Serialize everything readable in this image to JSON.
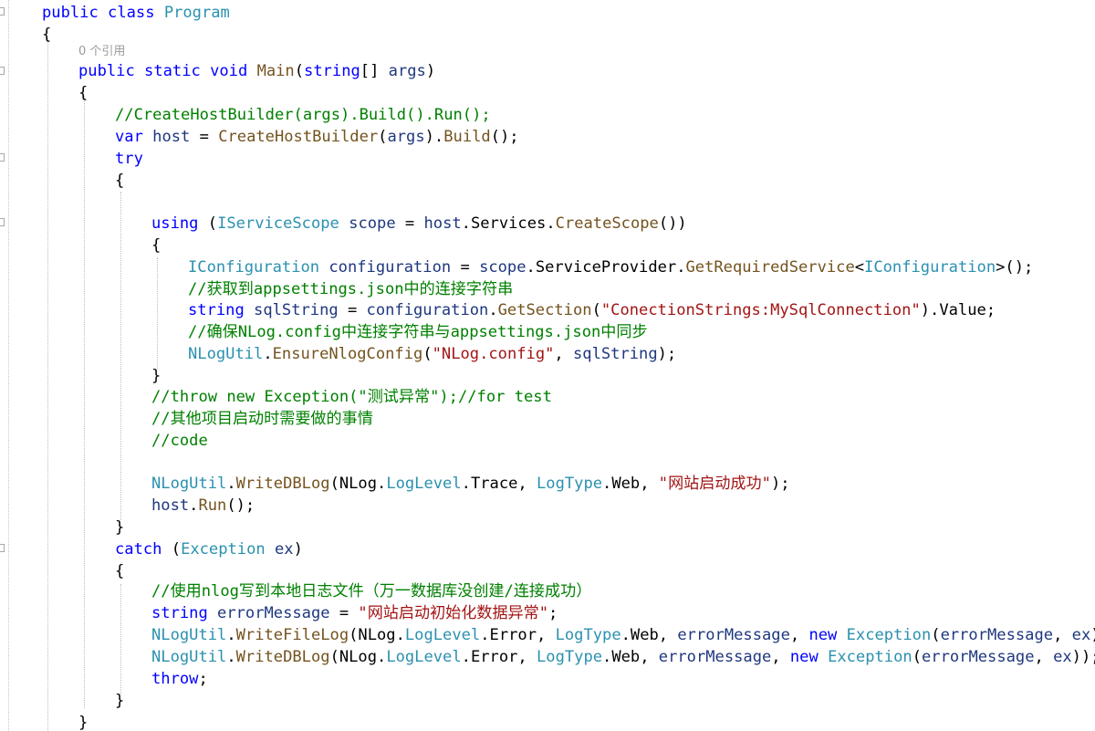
{
  "code_reference_label": "0 个引用",
  "lines": [
    {
      "indent": 1,
      "tokens": [
        {
          "k": "kw",
          "t": "public"
        },
        {
          "k": "pl",
          "t": " "
        },
        {
          "k": "kw",
          "t": "class"
        },
        {
          "k": "pl",
          "t": " "
        },
        {
          "k": "ty",
          "t": "Program"
        }
      ]
    },
    {
      "indent": 1,
      "tokens": [
        {
          "k": "pl",
          "t": "{"
        }
      ]
    },
    {
      "indent": 2,
      "tokens": [
        {
          "k": "kw",
          "t": "public"
        },
        {
          "k": "pl",
          "t": " "
        },
        {
          "k": "kw",
          "t": "static"
        },
        {
          "k": "pl",
          "t": " "
        },
        {
          "k": "kw",
          "t": "void"
        },
        {
          "k": "pl",
          "t": " "
        },
        {
          "k": "fn",
          "t": "Main"
        },
        {
          "k": "pl",
          "t": "("
        },
        {
          "k": "kw",
          "t": "string"
        },
        {
          "k": "pl",
          "t": "[] "
        },
        {
          "k": "vr",
          "t": "args"
        },
        {
          "k": "pl",
          "t": ")"
        }
      ]
    },
    {
      "indent": 2,
      "tokens": [
        {
          "k": "pl",
          "t": "{"
        }
      ]
    },
    {
      "indent": 3,
      "tokens": [
        {
          "k": "cm",
          "t": "//CreateHostBuilder(args).Build().Run();"
        }
      ]
    },
    {
      "indent": 3,
      "tokens": [
        {
          "k": "kw",
          "t": "var"
        },
        {
          "k": "pl",
          "t": " "
        },
        {
          "k": "vr",
          "t": "host"
        },
        {
          "k": "pl",
          "t": " = "
        },
        {
          "k": "fn",
          "t": "CreateHostBuilder"
        },
        {
          "k": "pl",
          "t": "("
        },
        {
          "k": "vr",
          "t": "args"
        },
        {
          "k": "pl",
          "t": ")."
        },
        {
          "k": "fn",
          "t": "Build"
        },
        {
          "k": "pl",
          "t": "();"
        }
      ]
    },
    {
      "indent": 3,
      "tokens": [
        {
          "k": "kw",
          "t": "try"
        }
      ]
    },
    {
      "indent": 3,
      "tokens": [
        {
          "k": "pl",
          "t": "{"
        }
      ]
    },
    {
      "indent": 0,
      "tokens": []
    },
    {
      "indent": 4,
      "tokens": [
        {
          "k": "kw",
          "t": "using"
        },
        {
          "k": "pl",
          "t": " ("
        },
        {
          "k": "ty",
          "t": "IServiceScope"
        },
        {
          "k": "pl",
          "t": " "
        },
        {
          "k": "vr",
          "t": "scope"
        },
        {
          "k": "pl",
          "t": " = "
        },
        {
          "k": "vr",
          "t": "host"
        },
        {
          "k": "pl",
          "t": "."
        },
        {
          "k": "pl",
          "t": "Services"
        },
        {
          "k": "pl",
          "t": "."
        },
        {
          "k": "fn",
          "t": "CreateScope"
        },
        {
          "k": "pl",
          "t": "())"
        }
      ]
    },
    {
      "indent": 4,
      "tokens": [
        {
          "k": "pl",
          "t": "{"
        }
      ]
    },
    {
      "indent": 5,
      "tokens": [
        {
          "k": "ty",
          "t": "IConfiguration"
        },
        {
          "k": "pl",
          "t": " "
        },
        {
          "k": "vr",
          "t": "configuration"
        },
        {
          "k": "pl",
          "t": " = "
        },
        {
          "k": "vr",
          "t": "scope"
        },
        {
          "k": "pl",
          "t": "."
        },
        {
          "k": "pl",
          "t": "ServiceProvider"
        },
        {
          "k": "pl",
          "t": "."
        },
        {
          "k": "fn",
          "t": "GetRequiredService"
        },
        {
          "k": "pl",
          "t": "<"
        },
        {
          "k": "ty",
          "t": "IConfiguration"
        },
        {
          "k": "pl",
          "t": ">();"
        }
      ]
    },
    {
      "indent": 5,
      "tokens": [
        {
          "k": "cm",
          "t": "//获取到appsettings.json中的连接字符串"
        }
      ]
    },
    {
      "indent": 5,
      "tokens": [
        {
          "k": "kw",
          "t": "string"
        },
        {
          "k": "pl",
          "t": " "
        },
        {
          "k": "vr",
          "t": "sqlString"
        },
        {
          "k": "pl",
          "t": " = "
        },
        {
          "k": "vr",
          "t": "configuration"
        },
        {
          "k": "pl",
          "t": "."
        },
        {
          "k": "fn",
          "t": "GetSection"
        },
        {
          "k": "pl",
          "t": "("
        },
        {
          "k": "st",
          "t": "\"ConectionStrings:MySqlConnection\""
        },
        {
          "k": "pl",
          "t": ").Value;"
        }
      ]
    },
    {
      "indent": 5,
      "tokens": [
        {
          "k": "cm",
          "t": "//确保NLog.config中连接字符串与appsettings.json中同步"
        }
      ]
    },
    {
      "indent": 5,
      "tokens": [
        {
          "k": "ty",
          "t": "NLogUtil"
        },
        {
          "k": "pl",
          "t": "."
        },
        {
          "k": "fn",
          "t": "EnsureNlogConfig"
        },
        {
          "k": "pl",
          "t": "("
        },
        {
          "k": "st",
          "t": "\"NLog.config\""
        },
        {
          "k": "pl",
          "t": ", "
        },
        {
          "k": "vr",
          "t": "sqlString"
        },
        {
          "k": "pl",
          "t": ");"
        }
      ]
    },
    {
      "indent": 4,
      "tokens": [
        {
          "k": "pl",
          "t": "}"
        }
      ]
    },
    {
      "indent": 4,
      "tokens": [
        {
          "k": "cm",
          "t": "//throw new Exception(\"测试异常\");//for test"
        }
      ]
    },
    {
      "indent": 4,
      "tokens": [
        {
          "k": "cm",
          "t": "//其他项目启动时需要做的事情"
        }
      ]
    },
    {
      "indent": 4,
      "tokens": [
        {
          "k": "cm",
          "t": "//code"
        }
      ]
    },
    {
      "indent": 0,
      "tokens": []
    },
    {
      "indent": 4,
      "tokens": [
        {
          "k": "ty",
          "t": "NLogUtil"
        },
        {
          "k": "pl",
          "t": "."
        },
        {
          "k": "fn",
          "t": "WriteDBLog"
        },
        {
          "k": "pl",
          "t": "(NLog."
        },
        {
          "k": "ty",
          "t": "LogLevel"
        },
        {
          "k": "pl",
          "t": ".Trace, "
        },
        {
          "k": "ty",
          "t": "LogType"
        },
        {
          "k": "pl",
          "t": ".Web, "
        },
        {
          "k": "st",
          "t": "\"网站启动成功\""
        },
        {
          "k": "pl",
          "t": ");"
        }
      ]
    },
    {
      "indent": 4,
      "tokens": [
        {
          "k": "vr",
          "t": "host"
        },
        {
          "k": "pl",
          "t": "."
        },
        {
          "k": "fn",
          "t": "Run"
        },
        {
          "k": "pl",
          "t": "();"
        }
      ]
    },
    {
      "indent": 3,
      "tokens": [
        {
          "k": "pl",
          "t": "}"
        }
      ]
    },
    {
      "indent": 3,
      "tokens": [
        {
          "k": "kw",
          "t": "catch"
        },
        {
          "k": "pl",
          "t": " ("
        },
        {
          "k": "ty",
          "t": "Exception"
        },
        {
          "k": "pl",
          "t": " "
        },
        {
          "k": "vr",
          "t": "ex"
        },
        {
          "k": "pl",
          "t": ")"
        }
      ]
    },
    {
      "indent": 3,
      "tokens": [
        {
          "k": "pl",
          "t": "{"
        }
      ]
    },
    {
      "indent": 4,
      "tokens": [
        {
          "k": "cm",
          "t": "//使用nlog写到本地日志文件（万一数据库没创建/连接成功）"
        }
      ]
    },
    {
      "indent": 4,
      "tokens": [
        {
          "k": "kw",
          "t": "string"
        },
        {
          "k": "pl",
          "t": " "
        },
        {
          "k": "vr",
          "t": "errorMessage"
        },
        {
          "k": "pl",
          "t": " = "
        },
        {
          "k": "st",
          "t": "\"网站启动初始化数据异常\""
        },
        {
          "k": "pl",
          "t": ";"
        }
      ]
    },
    {
      "indent": 4,
      "tokens": [
        {
          "k": "ty",
          "t": "NLogUtil"
        },
        {
          "k": "pl",
          "t": "."
        },
        {
          "k": "fn",
          "t": "WriteFileLog"
        },
        {
          "k": "pl",
          "t": "(NLog."
        },
        {
          "k": "ty",
          "t": "LogLevel"
        },
        {
          "k": "pl",
          "t": ".Error, "
        },
        {
          "k": "ty",
          "t": "LogType"
        },
        {
          "k": "pl",
          "t": ".Web, "
        },
        {
          "k": "vr",
          "t": "errorMessage"
        },
        {
          "k": "pl",
          "t": ", "
        },
        {
          "k": "kw",
          "t": "new"
        },
        {
          "k": "pl",
          "t": " "
        },
        {
          "k": "ty",
          "t": "Exception"
        },
        {
          "k": "pl",
          "t": "("
        },
        {
          "k": "vr",
          "t": "errorMessage"
        },
        {
          "k": "pl",
          "t": ", "
        },
        {
          "k": "vr",
          "t": "ex"
        },
        {
          "k": "pl",
          "t": "));"
        }
      ]
    },
    {
      "indent": 4,
      "tokens": [
        {
          "k": "ty",
          "t": "NLogUtil"
        },
        {
          "k": "pl",
          "t": "."
        },
        {
          "k": "fn",
          "t": "WriteDBLog"
        },
        {
          "k": "pl",
          "t": "(NLog."
        },
        {
          "k": "ty",
          "t": "LogLevel"
        },
        {
          "k": "pl",
          "t": ".Error, "
        },
        {
          "k": "ty",
          "t": "LogType"
        },
        {
          "k": "pl",
          "t": ".Web, "
        },
        {
          "k": "vr",
          "t": "errorMessage"
        },
        {
          "k": "pl",
          "t": ", "
        },
        {
          "k": "kw",
          "t": "new"
        },
        {
          "k": "pl",
          "t": " "
        },
        {
          "k": "ty",
          "t": "Exception"
        },
        {
          "k": "pl",
          "t": "("
        },
        {
          "k": "vr",
          "t": "errorMessage"
        },
        {
          "k": "pl",
          "t": ", "
        },
        {
          "k": "vr",
          "t": "ex"
        },
        {
          "k": "pl",
          "t": "));"
        }
      ]
    },
    {
      "indent": 4,
      "tokens": [
        {
          "k": "kw",
          "t": "throw"
        },
        {
          "k": "pl",
          "t": ";"
        }
      ]
    },
    {
      "indent": 3,
      "tokens": [
        {
          "k": "pl",
          "t": "}"
        }
      ]
    },
    {
      "indent": 2,
      "tokens": [
        {
          "k": "pl",
          "t": "}"
        }
      ]
    }
  ]
}
